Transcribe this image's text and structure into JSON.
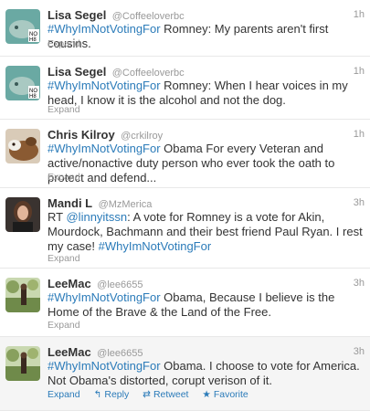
{
  "tweets": [
    {
      "name": "Lisa Segel",
      "handle": "@Coffeeloverbc",
      "time": "1h",
      "hashtag": "#WhyImNotVotingFor",
      "text": " Romney: My parents aren't first cousins.",
      "expand": "Expand",
      "avatar": "manatee-nono-avatar"
    },
    {
      "name": "Lisa Segel",
      "handle": "@Coffeeloverbc",
      "time": "1h",
      "hashtag": "#WhyImNotVotingFor",
      "text": " Romney: When I hear voices in my head, I know it is the alcohol and not the dog.",
      "expand": "Expand",
      "avatar": "manatee-nono-avatar"
    },
    {
      "name": "Chris Kilroy",
      "handle": "@crkilroy",
      "time": "1h",
      "hashtag": "#WhyImNotVotingFor",
      "text": " Obama For every Veteran and active/nonactive duty person who ever took the oath to protect and defend...",
      "expand": "Expand",
      "avatar": "dog-avatar"
    },
    {
      "name": "Mandi L",
      "handle": "@MzMerica",
      "time": "3h",
      "prefix": "RT ",
      "mention": "@linnyitssn",
      "text": ": A vote for Romney is a vote for Akin, Mourdock, Bachmann and their best friend Paul Ryan. I rest my case! ",
      "hashtag": "#WhyImNotVotingFor",
      "expand": "Expand",
      "avatar": "woman-avatar"
    },
    {
      "name": "LeeMac",
      "handle": "@lee6655",
      "time": "3h",
      "hashtag": "#WhyImNotVotingFor",
      "text": " Obama, Because I believe is the Home of the Brave & the Land of the Free.",
      "expand": "Expand",
      "avatar": "outdoor-avatar"
    },
    {
      "name": "LeeMac",
      "handle": "@lee6655",
      "time": "3h",
      "hashtag": "#WhyImNotVotingFor",
      "text": " Obama. I choose to vote for America. Not Obama's distorted, corupt verison of it.",
      "expand": "Expand",
      "reply": "Reply",
      "retweet": "Retweet",
      "favorite": "Favorite",
      "avatar": "outdoor-avatar"
    }
  ]
}
